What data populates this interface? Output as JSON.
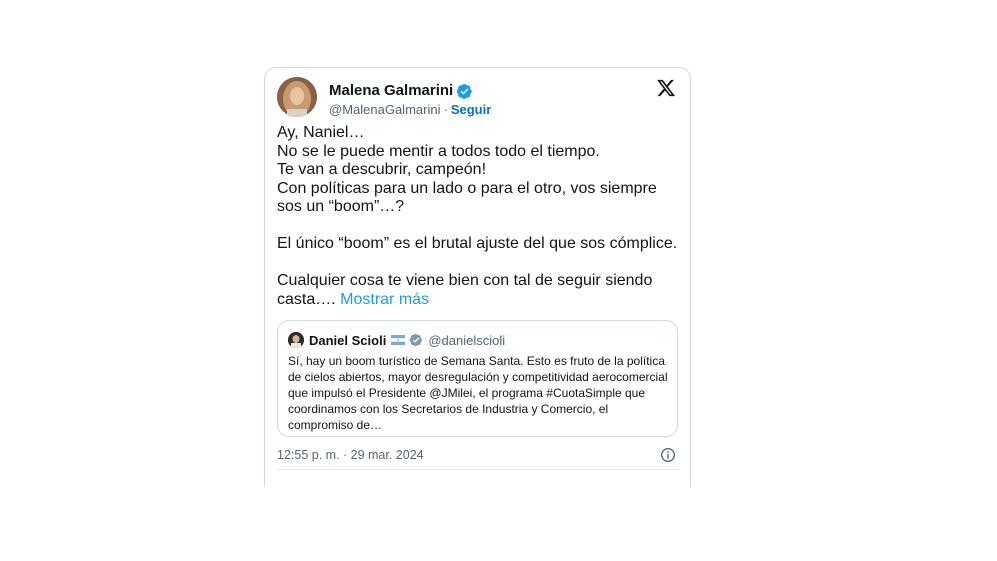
{
  "tweet": {
    "author_name": "Malena Galmarini",
    "author_handle": "@MalenaGalmarini",
    "separator": "·",
    "follow_label": "Seguir",
    "text": "Ay, Naniel…\nNo se le puede mentir a todos todo el tiempo.\nTe van a descubrir, campeón!\nCon políticas para un lado o para el otro, vos siempre sos un “boom”…?\n\nEl único “boom” es el brutal ajuste del que sos cómplice.\n\nCualquier cosa te viene bien con tal de seguir siendo casta….",
    "show_more_label": "Mostrar más",
    "timestamp": "12:55 p. m. · 29 mar. 2024"
  },
  "quote": {
    "author_name": "Daniel Scioli",
    "author_handle": "@danielscioli",
    "text": "Sí, hay un boom turístico de Semana Santa. Esto es fruto de la política de cielos abiertos, mayor desregulación y competitividad aerocomercial que impulsó el Presidente @JMilei, el programa #CuotaSimple que coordinamos con los Secretarios de Industria y Comercio, el compromiso de…"
  },
  "icons": {
    "platform_logo": "x-logo-icon",
    "verified": "verified-badge-icon",
    "flag": "argentina-flag-icon",
    "info": "info-icon"
  },
  "colors": {
    "link": "#1d9bf0",
    "follow": "#006fd6",
    "verified_blue": "#1d9bf0",
    "verified_gray": "#829aab",
    "border": "#cfd9de",
    "muted_text": "#536471"
  }
}
